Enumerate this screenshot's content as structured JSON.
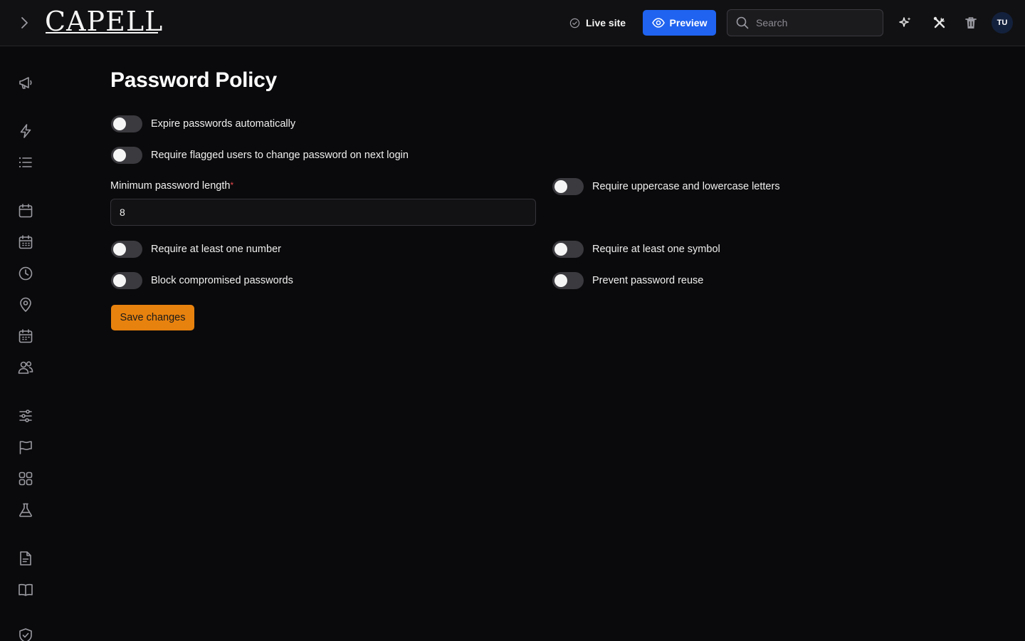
{
  "header": {
    "logo_text": "CAPELL",
    "live_site_label": "Live site",
    "preview_label": "Preview",
    "search_placeholder": "Search",
    "avatar_initials": "TU",
    "icons": [
      "chevron-right-icon",
      "check-circle-icon",
      "eye-icon",
      "search-icon",
      "sparkles-icon",
      "tools-icon",
      "trash-icon"
    ]
  },
  "sidebar": {
    "items": [
      {
        "icon": "megaphone-icon"
      },
      {
        "icon": "lightning-icon"
      },
      {
        "icon": "list-icon"
      },
      {
        "icon": "calendar-icon"
      },
      {
        "icon": "calendar-grid-icon"
      },
      {
        "icon": "clock-icon"
      },
      {
        "icon": "map-pin-icon"
      },
      {
        "icon": "calendar-dates-icon"
      },
      {
        "icon": "users-icon"
      },
      {
        "icon": "sliders-icon"
      },
      {
        "icon": "flag-icon"
      },
      {
        "icon": "grid-icon"
      },
      {
        "icon": "flask-icon"
      },
      {
        "icon": "document-icon"
      },
      {
        "icon": "book-icon"
      },
      {
        "icon": "shield-check-icon"
      }
    ]
  },
  "main": {
    "title": "Password Policy",
    "toggles": {
      "expire": {
        "label": "Expire passwords automatically",
        "enabled": false
      },
      "require_flagged": {
        "label": "Require flagged users to change password on next login",
        "enabled": false
      },
      "upper_lower": {
        "label": "Require uppercase and lowercase letters",
        "enabled": false
      },
      "number": {
        "label": "Require at least one number",
        "enabled": false
      },
      "symbol": {
        "label": "Require at least one symbol",
        "enabled": false
      },
      "block_compromised": {
        "label": "Block compromised passwords",
        "enabled": false
      },
      "prevent_reuse": {
        "label": "Prevent password reuse",
        "enabled": false
      }
    },
    "min_length": {
      "label": "Minimum password length",
      "required_mark": "*",
      "value": "8"
    },
    "save_label": "Save changes"
  },
  "colors": {
    "background": "#0a0a0c",
    "topbar": "#111113",
    "primary": "#1f63f0",
    "save": "#e8820e",
    "toggle_off": "#3a3a3f",
    "required": "#e5484d"
  }
}
